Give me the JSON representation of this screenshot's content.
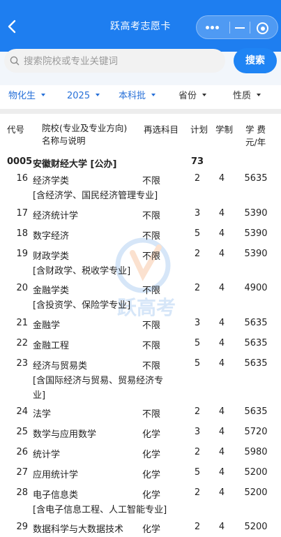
{
  "header": {
    "title": "跃高考志愿卡",
    "back_icon": "chevron-left-icon",
    "capsule_icons": [
      "more-dots-icon",
      "minimize-icon",
      "close-target-icon"
    ],
    "color": "#1e7ef0"
  },
  "search": {
    "placeholder": "搜索院校或专业关键词",
    "button_label": "搜索"
  },
  "filters": [
    {
      "label": "物化生",
      "active": true
    },
    {
      "label": "2025",
      "active": true
    },
    {
      "label": "本科批",
      "active": true
    },
    {
      "label": "省份",
      "active": false
    },
    {
      "label": "性质",
      "active": false
    }
  ],
  "table": {
    "headers": {
      "code": "代号",
      "name_line1": "院校(专业及专业方向)",
      "name_line2": "名称与说明",
      "subject": "再选科目",
      "plan": "计划",
      "length": "学制",
      "fee_line1": "学 费",
      "fee_line2": "元/年"
    },
    "school": {
      "code": "0005",
      "name": "安徽财经大学 [公办]",
      "plan": "73"
    },
    "rows": [
      {
        "code": "16",
        "name": "经济学类",
        "note": "[含经济学、国民经济管理专业]",
        "subject": "不限",
        "plan": "2",
        "length": "4",
        "fee": "5635"
      },
      {
        "code": "17",
        "name": "经济统计学",
        "note": "",
        "subject": "不限",
        "plan": "3",
        "length": "4",
        "fee": "5390"
      },
      {
        "code": "18",
        "name": "数字经济",
        "note": "",
        "subject": "不限",
        "plan": "5",
        "length": "4",
        "fee": "5390"
      },
      {
        "code": "19",
        "name": "财政学类",
        "note": "[含财政学、税收学专业]",
        "subject": "不限",
        "plan": "2",
        "length": "4",
        "fee": "5390"
      },
      {
        "code": "20",
        "name": "金融学类",
        "note": "[含投资学、保险学专业]",
        "subject": "不限",
        "plan": "2",
        "length": "4",
        "fee": "4900"
      },
      {
        "code": "21",
        "name": "金融学",
        "note": "",
        "subject": "不限",
        "plan": "3",
        "length": "4",
        "fee": "5635"
      },
      {
        "code": "22",
        "name": "金融工程",
        "note": "",
        "subject": "不限",
        "plan": "5",
        "length": "4",
        "fee": "5635"
      },
      {
        "code": "23",
        "name": "经济与贸易类",
        "note": "[含国际经济与贸易、贸易经济专",
        "note2": "业]",
        "subject": "不限",
        "plan": "5",
        "length": "4",
        "fee": "5635"
      },
      {
        "code": "24",
        "name": "法学",
        "note": "",
        "subject": "不限",
        "plan": "2",
        "length": "4",
        "fee": "5635"
      },
      {
        "code": "25",
        "name": "数学与应用数学",
        "note": "",
        "subject": "化学",
        "plan": "3",
        "length": "4",
        "fee": "5720"
      },
      {
        "code": "26",
        "name": "统计学",
        "note": "",
        "subject": "化学",
        "plan": "2",
        "length": "4",
        "fee": "5980"
      },
      {
        "code": "27",
        "name": "应用统计学",
        "note": "",
        "subject": "化学",
        "plan": "5",
        "length": "4",
        "fee": "5200"
      },
      {
        "code": "28",
        "name": "电子信息类",
        "note": "[含电子信息工程、人工智能专业]",
        "subject": "化学",
        "plan": "2",
        "length": "4",
        "fee": "5200"
      },
      {
        "code": "29",
        "name": "数据科学与大数据技术",
        "note": "",
        "subject": "化学",
        "plan": "2",
        "length": "4",
        "fee": "5200"
      }
    ]
  },
  "watermark_text": "跃高考"
}
